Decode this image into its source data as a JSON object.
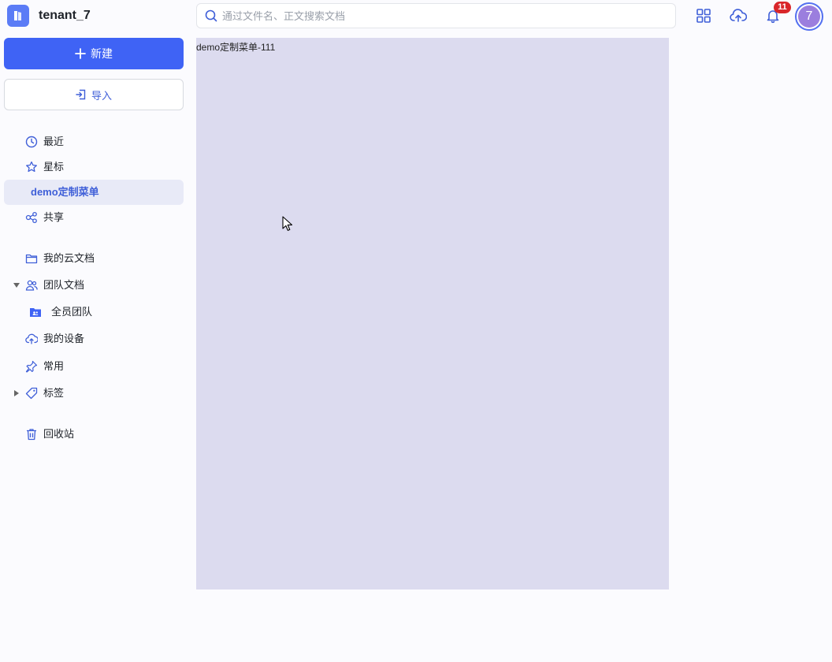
{
  "header": {
    "tenant_name": "tenant_7",
    "search_placeholder": "通过文件名、正文搜索文档",
    "notification_count": "11",
    "avatar_initial": "7",
    "accent_color": "#3f63f5"
  },
  "sidebar": {
    "new_button": "新建",
    "import_button": "导入",
    "items": [
      {
        "label": "最近",
        "icon": "clock-icon"
      },
      {
        "label": "星标",
        "icon": "star-icon"
      },
      {
        "label": "demo定制菜单",
        "icon": "",
        "active": true
      },
      {
        "label": "共享",
        "icon": "share-icon"
      },
      {
        "label": "我的云文档",
        "icon": "folder-icon"
      },
      {
        "label": "团队文档",
        "icon": "team-icon",
        "expanded": true
      },
      {
        "label": "全员团队",
        "icon": "team-folder-icon"
      },
      {
        "label": "我的设备",
        "icon": "cloud-upload-icon"
      },
      {
        "label": "常用",
        "icon": "pin-icon"
      },
      {
        "label": "标签",
        "icon": "tag-icon",
        "expanded": false
      },
      {
        "label": "回收站",
        "icon": "trash-icon"
      }
    ]
  },
  "main": {
    "content_text": "demo定制菜单-111"
  }
}
